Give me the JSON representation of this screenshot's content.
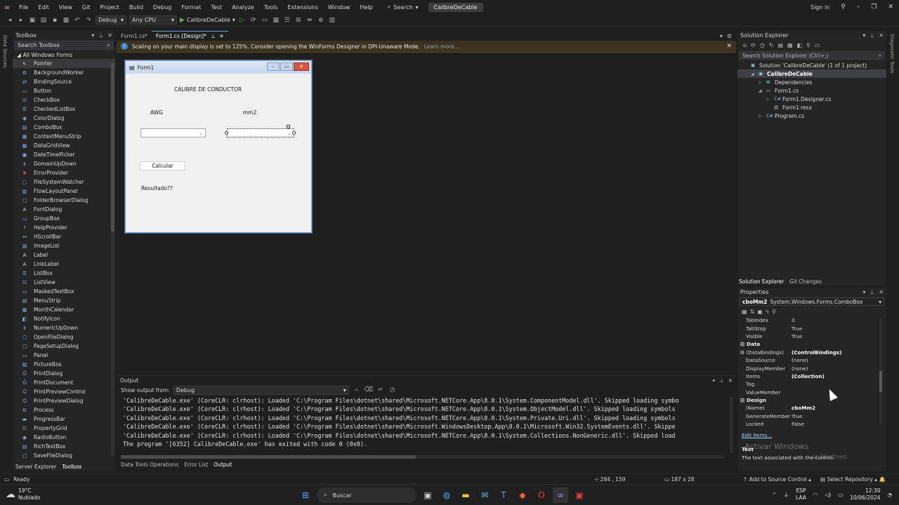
{
  "app": {
    "menu": [
      "File",
      "Edit",
      "View",
      "Git",
      "Project",
      "Build",
      "Debug",
      "Format",
      "Test",
      "Analyze",
      "Tools",
      "Extensions",
      "Window",
      "Help"
    ],
    "search_label": "Search",
    "project_name": "CalibreDeCable",
    "sign_in": "Sign in"
  },
  "toolbar": {
    "config": "Debug",
    "platform": "Any CPU",
    "start_label": "CalibreDeCable"
  },
  "left_strip_label": "Data Sources",
  "toolbox": {
    "title": "Toolbox",
    "search_placeholder": "Search Toolbox",
    "group": "All Windows Forms",
    "items": [
      {
        "label": "Pointer",
        "icon": "↖"
      },
      {
        "label": "BackgroundWorker",
        "icon": "⚙"
      },
      {
        "label": "BindingSource",
        "icon": "⇄"
      },
      {
        "label": "Button",
        "icon": "▭"
      },
      {
        "label": "CheckBox",
        "icon": "☑"
      },
      {
        "label": "CheckedListBox",
        "icon": "☰"
      },
      {
        "label": "ColorDialog",
        "icon": "◉"
      },
      {
        "label": "ComboBox",
        "icon": "▤"
      },
      {
        "label": "ContextMenuStrip",
        "icon": "▦"
      },
      {
        "label": "DataGridView",
        "icon": "▦"
      },
      {
        "label": "DateTimePicker",
        "icon": "▣"
      },
      {
        "label": "DomainUpDown",
        "icon": "⇕"
      },
      {
        "label": "ErrorProvider",
        "icon": "✖"
      },
      {
        "label": "FileSystemWatcher",
        "icon": "▢"
      },
      {
        "label": "FlowLayoutPanel",
        "icon": "▥"
      },
      {
        "label": "FolderBrowserDialog",
        "icon": "▢"
      },
      {
        "label": "FontDialog",
        "icon": "A"
      },
      {
        "label": "GroupBox",
        "icon": "▭"
      },
      {
        "label": "HelpProvider",
        "icon": "?"
      },
      {
        "label": "HScrollBar",
        "icon": "↔"
      },
      {
        "label": "ImageList",
        "icon": "▨"
      },
      {
        "label": "Label",
        "icon": "A"
      },
      {
        "label": "LinkLabel",
        "icon": "A"
      },
      {
        "label": "ListBox",
        "icon": "☰"
      },
      {
        "label": "ListView",
        "icon": "☷"
      },
      {
        "label": "MaskedTextBox",
        "icon": "▭"
      },
      {
        "label": "MenuStrip",
        "icon": "▤"
      },
      {
        "label": "MonthCalendar",
        "icon": "▦"
      },
      {
        "label": "NotifyIcon",
        "icon": "◧"
      },
      {
        "label": "NumericUpDown",
        "icon": "⇕"
      },
      {
        "label": "OpenFileDialog",
        "icon": "▢"
      },
      {
        "label": "PageSetupDialog",
        "icon": "▢"
      },
      {
        "label": "Panel",
        "icon": "▭"
      },
      {
        "label": "PictureBox",
        "icon": "▨"
      },
      {
        "label": "PrintDialog",
        "icon": "⎙"
      },
      {
        "label": "PrintDocument",
        "icon": "⎙"
      },
      {
        "label": "PrintPreviewControl",
        "icon": "⎙"
      },
      {
        "label": "PrintPreviewDialog",
        "icon": "⎙"
      },
      {
        "label": "Process",
        "icon": "⚙"
      },
      {
        "label": "ProgressBar",
        "icon": "▬"
      },
      {
        "label": "PropertyGrid",
        "icon": "☷"
      },
      {
        "label": "RadioButton",
        "icon": "◉"
      },
      {
        "label": "RichTextBox",
        "icon": "▤"
      },
      {
        "label": "SaveFileDialog",
        "icon": "▢"
      }
    ],
    "tabs": [
      "Server Explorer",
      "Toolbox"
    ]
  },
  "editor": {
    "tabs": [
      {
        "label": "Form1.cs*",
        "active": false
      },
      {
        "label": "Form1.cs [Design]*",
        "active": true
      }
    ],
    "info_message": "Scaling on your main display is set to 125%. Consider opening the WinForms Designer in DPI-Unaware Mode.",
    "info_link": "Learn more..."
  },
  "form": {
    "title": "Form1",
    "heading": "CALIBRE DE CONDUCTOR",
    "label_awg": "AWG",
    "label_mm2": "mm2",
    "button": "Calcular",
    "result": "Resultado??"
  },
  "output": {
    "title": "Output",
    "show_from_label": "Show output from:",
    "show_from_value": "Debug",
    "lines": [
      "'CalibreDeCable.exe' (CoreCLR: clrhost): Loaded 'C:\\Program Files\\dotnet\\shared\\Microsoft.NETCore.App\\8.0.1\\System.ComponentModel.dll'. Skipped loading symbo",
      "'CalibreDeCable.exe' (CoreCLR: clrhost): Loaded 'C:\\Program Files\\dotnet\\shared\\Microsoft.NETCore.App\\8.0.1\\System.ObjectModel.dll'. Skipped loading symbols",
      "'CalibreDeCable.exe' (CoreCLR: clrhost): Loaded 'C:\\Program Files\\dotnet\\shared\\Microsoft.NETCore.App\\8.0.1\\System.Private.Uri.dll'. Skipped loading symbols",
      "'CalibreDeCable.exe' (CoreCLR: clrhost): Loaded 'C:\\Program Files\\dotnet\\shared\\Microsoft.WindowsDesktop.App\\8.0.1\\Microsoft.Win32.SystemEvents.dll'. Skippe",
      "'CalibreDeCable.exe' (CoreCLR: clrhost): Loaded 'C:\\Program Files\\dotnet\\shared\\Microsoft.NETCore.App\\8.0.1\\System.Collections.NonGeneric.dll'. Skipped load",
      "The program '[6352] CalibreDeCable.exe' has exited with code 0 (0x0)."
    ],
    "tabs": [
      "Data Tools Operations",
      "Error List",
      "Output"
    ]
  },
  "solution_explorer": {
    "title": "Solution Explorer",
    "search_placeholder": "Search Solution Explorer (Ctrl+;)",
    "nodes": [
      {
        "label": "Solution 'CalibreDeCable' (1 of 1 project)",
        "indent": 0,
        "exp": "",
        "icon": "▣",
        "sel": false
      },
      {
        "label": "CalibreDeCable",
        "indent": 1,
        "exp": "◢",
        "icon": "▣",
        "sel": true
      },
      {
        "label": "Dependencies",
        "indent": 2,
        "exp": "▷",
        "icon": "⊞",
        "sel": false
      },
      {
        "label": "Form1.cs",
        "indent": 2,
        "exp": "◢",
        "icon": "▭",
        "sel": false
      },
      {
        "label": "Form1.Designer.cs",
        "indent": 3,
        "exp": "▷",
        "icon": "C#",
        "sel": false
      },
      {
        "label": "Form1.resx",
        "indent": 3,
        "exp": "",
        "icon": "▤",
        "sel": false
      },
      {
        "label": "Program.cs",
        "indent": 2,
        "exp": "▷",
        "icon": "C#",
        "sel": false
      }
    ],
    "tabs": [
      "Solution Explorer",
      "Git Changes"
    ]
  },
  "properties": {
    "title": "Properties",
    "object_name": "cboMm2",
    "object_type": "System.Windows.Forms.ComboBox",
    "rows": [
      {
        "kind": "prop",
        "key": "TabIndex",
        "value": "3",
        "bold": false
      },
      {
        "kind": "prop",
        "key": "TabStop",
        "value": "True",
        "bold": false
      },
      {
        "kind": "prop",
        "key": "Visible",
        "value": "True",
        "bold": false
      },
      {
        "kind": "cat",
        "key": "Data"
      },
      {
        "kind": "prop",
        "key": "(DataBindings)",
        "value": "(ControlBindings)",
        "bold": true,
        "exp": "⊞"
      },
      {
        "kind": "prop",
        "key": "DataSource",
        "value": "(none)",
        "bold": false
      },
      {
        "kind": "prop",
        "key": "DisplayMember",
        "value": "(none)",
        "bold": false
      },
      {
        "kind": "prop",
        "key": "Items",
        "value": "(Collection)",
        "bold": true
      },
      {
        "kind": "prop",
        "key": "Tag",
        "value": "",
        "bold": false
      },
      {
        "kind": "prop",
        "key": "ValueMember",
        "value": "",
        "bold": false
      },
      {
        "kind": "cat",
        "key": "Design"
      },
      {
        "kind": "prop",
        "key": "(Name)",
        "value": "cboMm2",
        "bold": true
      },
      {
        "kind": "prop",
        "key": "GenerateMember",
        "value": "True",
        "bold": false
      },
      {
        "kind": "prop",
        "key": "Locked",
        "value": "False",
        "bold": false
      }
    ],
    "edit_items": "Edit Items...",
    "desc_title": "Text",
    "desc_text": "The text associated with the control.",
    "watermark1": "Activar Windows",
    "watermark2": "ar Windows."
  },
  "right_strip_label": "Diagnostic Tools",
  "status": {
    "ready": "Ready",
    "position": "284 , 159",
    "size": "187 x 28",
    "source_control": "Add to Source Control",
    "repository": "Select Repository"
  },
  "taskbar": {
    "temp": "19°C",
    "weather": "Nublado",
    "search": "Buscar",
    "lang1": "ESP",
    "lang2": "LAA",
    "time": "12:30",
    "date": "10/06/2024"
  }
}
